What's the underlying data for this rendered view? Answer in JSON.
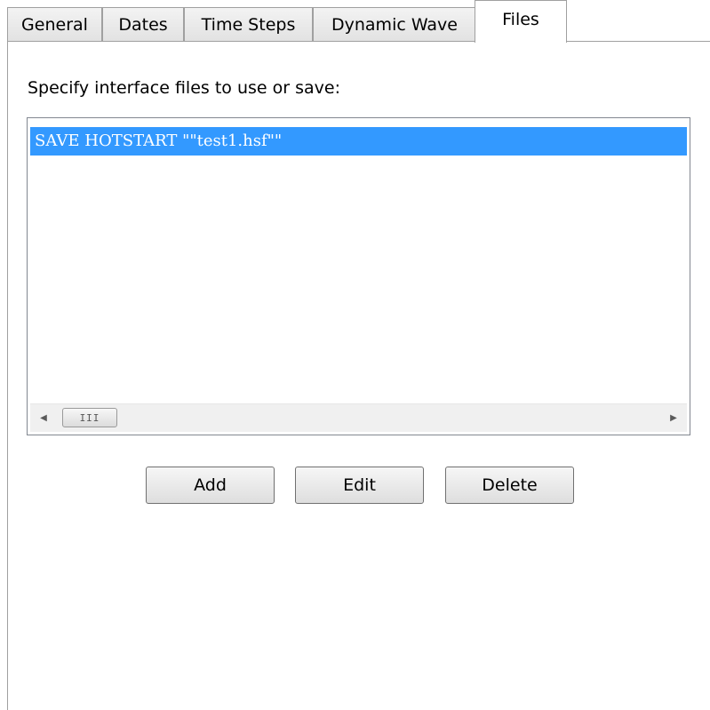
{
  "tabs": [
    {
      "label": "General"
    },
    {
      "label": "Dates"
    },
    {
      "label": "Time Steps"
    },
    {
      "label": "Dynamic Wave"
    },
    {
      "label": "Files"
    }
  ],
  "active_tab": "Files",
  "instruction": "Specify interface files to use or save:",
  "files_list": {
    "items": [
      {
        "text": "SAVE HOTSTART \"\"test1.hsf\"\"",
        "selected": true
      }
    ],
    "scrollbar": {
      "left_arrow": "◀",
      "right_arrow": "▶",
      "thumb_grip": "III"
    }
  },
  "buttons": {
    "add": "Add",
    "edit": "Edit",
    "delete": "Delete"
  },
  "colors": {
    "selection": "#3399ff"
  }
}
